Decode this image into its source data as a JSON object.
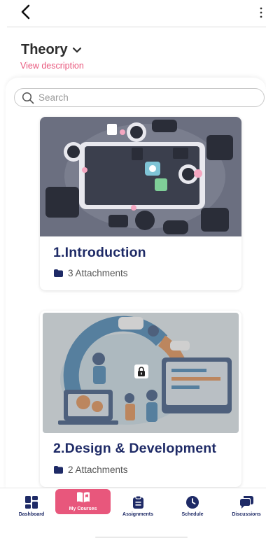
{
  "header": {
    "title": "Theory",
    "view_description": "View description"
  },
  "search": {
    "placeholder": "Search"
  },
  "courses": [
    {
      "title": "1.Introduction",
      "attachments": "3 Attachments",
      "locked": false
    },
    {
      "title": "2.Design & Development",
      "attachments": "2 Attachments",
      "locked": true
    }
  ],
  "bottom_nav": {
    "items": [
      {
        "label": "Dashboard",
        "icon": "dashboard-icon"
      },
      {
        "label": "My Courses",
        "icon": "book-icon",
        "active": true
      },
      {
        "label": "Assignments",
        "icon": "clipboard-icon"
      },
      {
        "label": "Schedule",
        "icon": "clock-icon"
      },
      {
        "label": "Discussions",
        "icon": "chat-icon"
      }
    ]
  },
  "colors": {
    "accent": "#e8577c",
    "navy": "#1e2a66",
    "text": "#2c2c2c"
  }
}
